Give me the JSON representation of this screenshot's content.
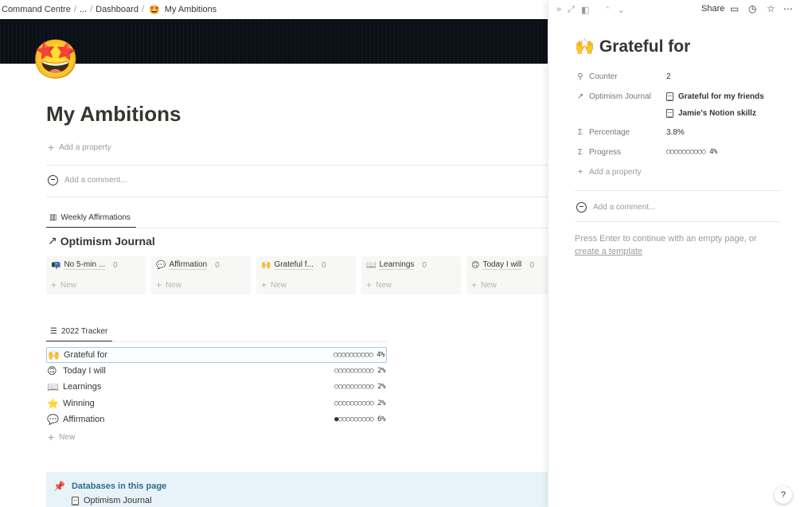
{
  "breadcrumb": {
    "items": [
      "Command Centre",
      "...",
      "Dashboard"
    ],
    "current_emoji": "🤩",
    "current": "My Ambitions"
  },
  "page": {
    "icon": "🤩",
    "title": "My Ambitions",
    "add_property": "Add a property",
    "add_comment": "Add a comment..."
  },
  "board_view": {
    "tab_label": "Weekly Affirmations",
    "tab_icon": "board-icon",
    "database_title": "Optimism Journal",
    "columns": [
      {
        "emoji": "📭",
        "label": "No 5-min ...",
        "count": "0",
        "new": "New"
      },
      {
        "emoji": "💬",
        "label": "Affirmation",
        "count": "0",
        "new": "New"
      },
      {
        "emoji": "🙌",
        "label": "Grateful f...",
        "count": "0",
        "new": "New"
      },
      {
        "emoji": "📖",
        "label": "Learnings",
        "count": "0",
        "new": "New"
      },
      {
        "emoji": "🙃",
        "label": "Today I will",
        "count": "0",
        "new": "New"
      }
    ]
  },
  "tracker": {
    "tab_label": "2022 Tracker",
    "tab_icon": "list-icon",
    "rows": [
      {
        "emoji": "🙌",
        "name": "Grateful for",
        "progress": "○○○○○○○○○○ 4%",
        "progress_value": 4
      },
      {
        "emoji": "🙃",
        "name": "Today I will",
        "progress": "○○○○○○○○○○ 2%",
        "progress_value": 2
      },
      {
        "emoji": "📖",
        "name": "Learnings",
        "progress": "○○○○○○○○○○ 2%",
        "progress_value": 2
      },
      {
        "emoji": "⭐",
        "name": "Winning",
        "progress": "○○○○○○○○○○ 2%",
        "progress_value": 2
      },
      {
        "emoji": "💬",
        "name": "Affirmation",
        "progress": "●○○○○○○○○○ 6%",
        "progress_value": 6
      }
    ],
    "new_label": "New"
  },
  "callout": {
    "icon": "📌",
    "title": "Databases in this page",
    "item": "Optimism Journal"
  },
  "peek": {
    "share_label": "Share",
    "title_emoji": "🙌",
    "title": "Grateful for",
    "properties": {
      "counter": {
        "label": "Counter",
        "value": "2"
      },
      "journal": {
        "label": "Optimism Journal",
        "relations": [
          "Grateful for my friends",
          "Jamie's Notion skillz"
        ]
      },
      "percentage": {
        "label": "Percentage",
        "value": "3.8%"
      },
      "progress": {
        "label": "Progress",
        "value": "○○○○○○○○○○ 4%",
        "progress_value": 4
      }
    },
    "add_property": "Add a property",
    "add_comment": "Add a comment...",
    "hint_text": "Press Enter to continue with an empty page, or",
    "hint_link": "create a template",
    "help": "?"
  },
  "colors": {
    "text": "#37352f",
    "muted": "#9b9a97",
    "callout_bg": "#e7f3f8",
    "callout_title": "#2f6b8e",
    "cover": "#0b0f16",
    "selection_border": "#a7c7e8"
  }
}
